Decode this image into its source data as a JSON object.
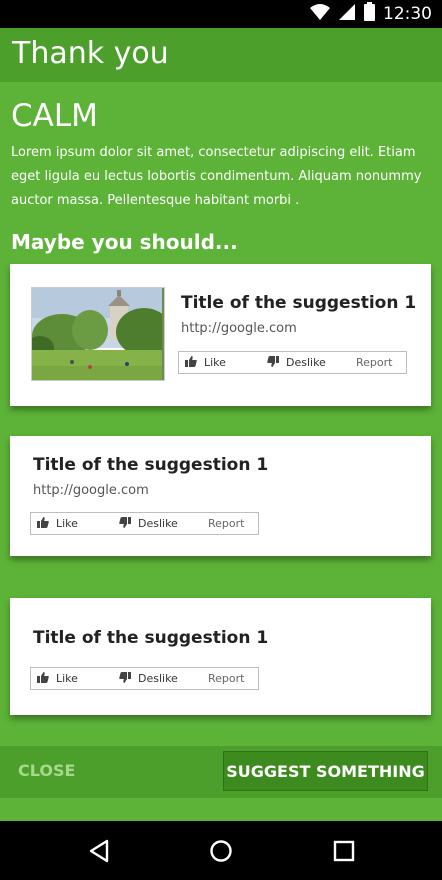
{
  "status_bar": {
    "time": "12:30",
    "icons": [
      "wifi-icon",
      "signal-icon",
      "battery-icon"
    ]
  },
  "app_bar": {
    "title": "Thank you"
  },
  "main": {
    "heading": "CALM",
    "description": "Lorem ipsum dolor sit amet, consectetur adipiscing elit. Etiam eget ligula eu lectus lobortis condimentum. Aliquam nonummy auctor massa. Pellentesque habitant morbi .",
    "subheading": "Maybe you should..."
  },
  "suggestions": [
    {
      "title": "Title of the suggestion 1",
      "url": "http://google.com",
      "has_image": true,
      "like_label": "Like",
      "dislike_label": "Deslike",
      "report_label": "Report"
    },
    {
      "title": "Title of the suggestion 1",
      "url": "http://google.com",
      "has_image": false,
      "like_label": "Like",
      "dislike_label": "Deslike",
      "report_label": "Report"
    },
    {
      "title": "Title of the suggestion 1",
      "url": "",
      "has_image": false,
      "like_label": "Like",
      "dislike_label": "Deslike",
      "report_label": "Report"
    }
  ],
  "bottom_bar": {
    "close_label": "CLOSE",
    "suggest_label": "SUGGEST SOMETHING"
  },
  "nav_bar": {
    "icons": [
      "back-icon",
      "home-icon",
      "recents-icon"
    ]
  },
  "colors": {
    "primary": "#5cb337",
    "primary_dark": "#4c9f2b",
    "button": "#3d8a1f"
  }
}
